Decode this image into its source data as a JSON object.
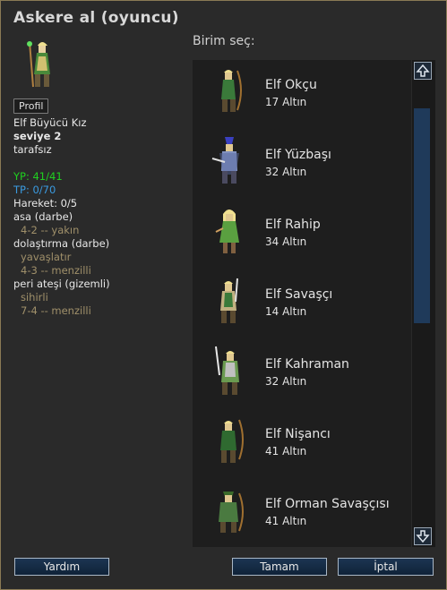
{
  "dialog": {
    "title": "Askere al (oyuncu)"
  },
  "leader": {
    "profile_button": "Profil",
    "unit_type": "Elf Büyücü Kız",
    "level": "seviye 2",
    "alignment": "tarafsız",
    "hp": "YP: 41/41",
    "xp": "TP: 0/70",
    "moves": "Hareket: 0/5",
    "attacks": [
      {
        "name": "asa (darbe)",
        "specials": "",
        "damage": "4-2 -- yakın"
      },
      {
        "name": "dolaştırma (darbe)",
        "specials": "yavaşlatır",
        "damage": "4-3 -- menzilli"
      },
      {
        "name": "peri ateşi (gizemli)",
        "specials": "sihirli",
        "damage": "7-4 -- menzilli"
      }
    ]
  },
  "list": {
    "label": "Birim seç:",
    "units": [
      {
        "name": "Elf Okçu",
        "cost": "17 Altın",
        "icon": "elf-archer-sprite"
      },
      {
        "name": "Elf Yüzbaşı",
        "cost": "32 Altın",
        "icon": "elf-captain-sprite"
      },
      {
        "name": "Elf Rahip",
        "cost": "34 Altın",
        "icon": "elf-shaman-sprite"
      },
      {
        "name": "Elf Savaşçı",
        "cost": "14 Altın",
        "icon": "elf-fighter-sprite"
      },
      {
        "name": "Elf Kahraman",
        "cost": "32 Altın",
        "icon": "elf-hero-sprite"
      },
      {
        "name": "Elf Nişancı",
        "cost": "41 Altın",
        "icon": "elf-marksman-sprite"
      },
      {
        "name": "Elf Orman Savaşçısı",
        "cost": "41 Altın",
        "icon": "elf-ranger-sprite"
      }
    ]
  },
  "buttons": {
    "help": "Yardım",
    "ok": "Tamam",
    "cancel": "İptal"
  },
  "colors": {
    "frame": "#8a7a55",
    "hp": "#20d020",
    "xp": "#3a9ae0",
    "attack_detail": "#a0906a",
    "button": "#1c3552"
  }
}
